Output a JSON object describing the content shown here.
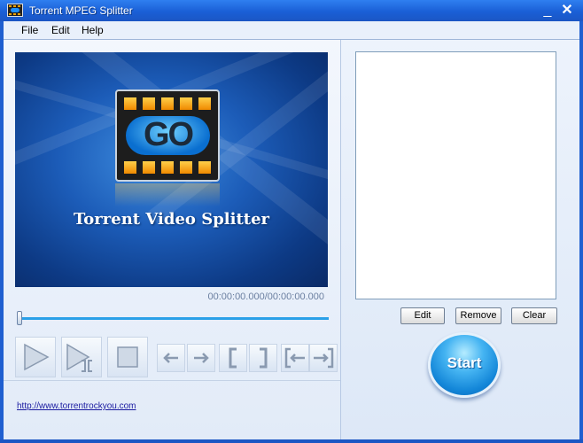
{
  "window": {
    "title": "Torrent MPEG Splitter",
    "minimize_glyph": "_",
    "close_glyph": "✕"
  },
  "menu": {
    "items": [
      "File",
      "Edit",
      "Help"
    ]
  },
  "preview": {
    "caption": "Torrent Video Splitter",
    "logo_text": "GO"
  },
  "player": {
    "timecode": "00:00:00.000/00:00:00.000",
    "position_fraction": 0.0
  },
  "controls": {
    "icons": [
      "play-icon",
      "play-segment-icon",
      "stop-icon",
      "arrow-left-icon",
      "arrow-right-icon",
      "bracket-start-icon",
      "bracket-end-icon",
      "goto-start-icon",
      "goto-end-icon"
    ]
  },
  "footer": {
    "url": "http://www.torrentrockyou.com"
  },
  "file_list": {
    "items": []
  },
  "buttons": {
    "edit": "Edit",
    "remove": "Remove",
    "clear": "Clear",
    "start": "Start"
  },
  "colors": {
    "title_bar": "#1a5fd6",
    "accent": "#2aa0e8",
    "start": "#1386d8"
  }
}
